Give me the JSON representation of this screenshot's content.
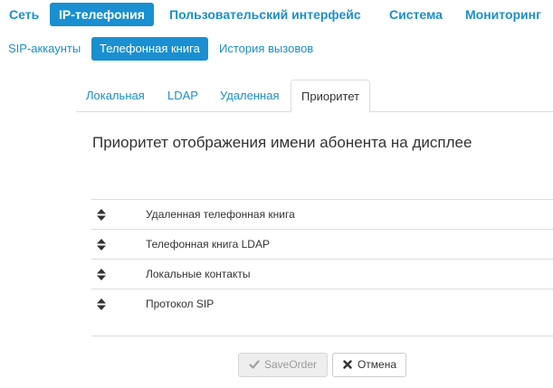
{
  "top_nav": {
    "items": [
      {
        "label": "Сеть"
      },
      {
        "label": "IP-телефония",
        "active": true
      },
      {
        "label": "Пользовательский интерфейс"
      },
      {
        "label": "Система"
      },
      {
        "label": "Мониторинг"
      }
    ]
  },
  "sub_nav": {
    "items": [
      {
        "label": "SIP-аккаунты"
      },
      {
        "label": "Телефонная книга",
        "active": true
      },
      {
        "label": "История вызовов"
      }
    ]
  },
  "tabs": {
    "items": [
      {
        "label": "Локальная"
      },
      {
        "label": "LDAP"
      },
      {
        "label": "Удаленная"
      },
      {
        "label": "Приоритет",
        "active": true
      }
    ]
  },
  "page": {
    "heading": "Приоритет отображения имени абонента на дисплее"
  },
  "priority_list": {
    "handle_icon": "sort-icon",
    "items": [
      {
        "label": "Удаленная телефонная книга"
      },
      {
        "label": "Телефонная книга LDAP"
      },
      {
        "label": "Локальные контакты"
      },
      {
        "label": "Протокол SIP"
      }
    ]
  },
  "actions": {
    "save_label": "SaveOrder",
    "save_icon": "check-icon",
    "save_disabled": true,
    "cancel_label": "Отмена",
    "cancel_icon": "close-icon"
  },
  "colors": {
    "accent": "#1a8fd1",
    "text": "#333333",
    "border": "#dddddd"
  }
}
